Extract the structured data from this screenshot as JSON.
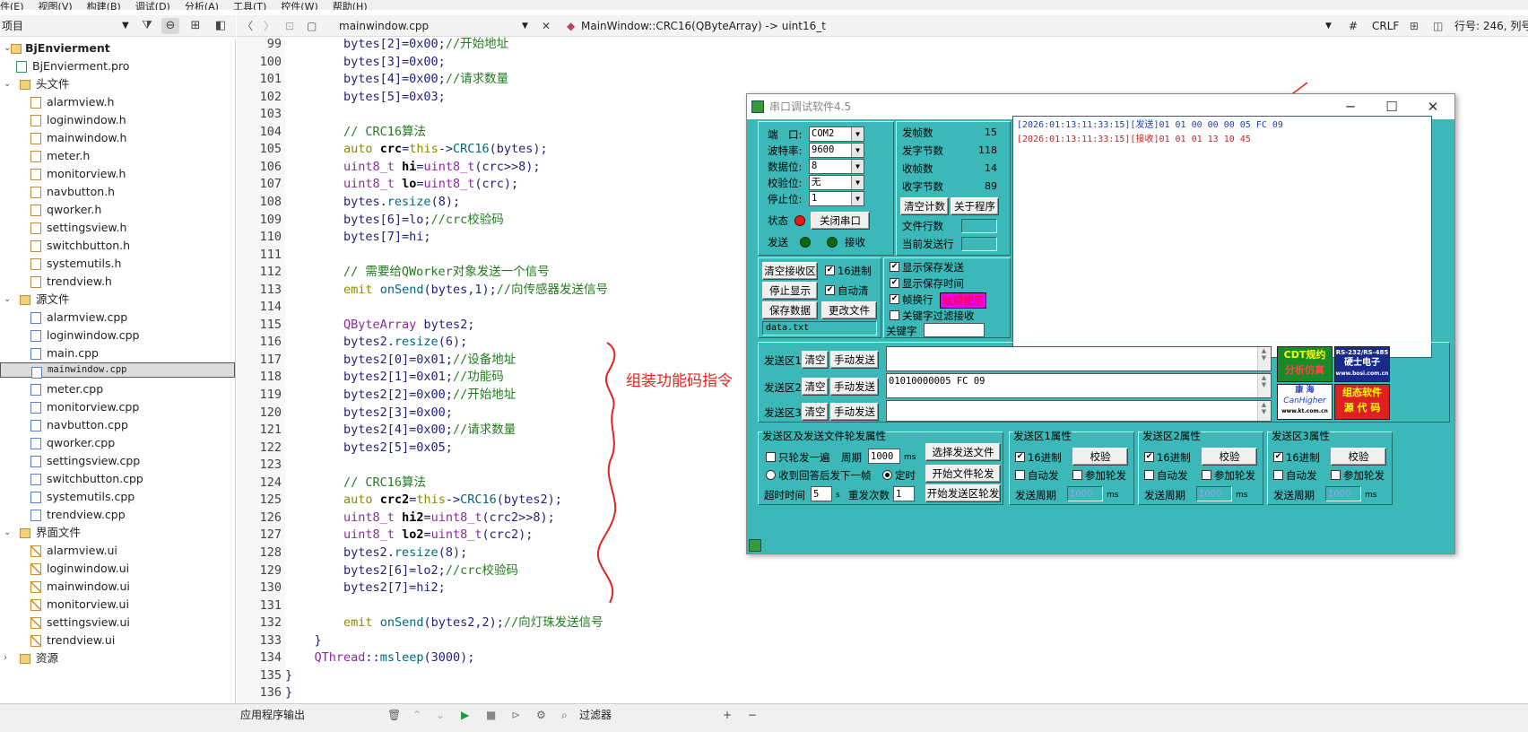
{
  "menu": [
    "件(E)",
    "视图(V)",
    "构建(B)",
    "调试(D)",
    "分析(A)",
    "工具(T)",
    "控件(W)",
    "帮助(H)"
  ],
  "left_toolbar": {
    "combo_label": "项目"
  },
  "tree": {
    "project": "BjEnvierment",
    "items": [
      {
        "label": "BjEnvierment.pro",
        "level": 1,
        "kind": "pro"
      },
      {
        "label": "头文件",
        "level": 1,
        "kind": "folder"
      },
      {
        "label": "alarmview.h",
        "level": 2,
        "kind": "h"
      },
      {
        "label": "loginwindow.h",
        "level": 2,
        "kind": "h"
      },
      {
        "label": "mainwindow.h",
        "level": 2,
        "kind": "h"
      },
      {
        "label": "meter.h",
        "level": 2,
        "kind": "h"
      },
      {
        "label": "monitorview.h",
        "level": 2,
        "kind": "h"
      },
      {
        "label": "navbutton.h",
        "level": 2,
        "kind": "h"
      },
      {
        "label": "qworker.h",
        "level": 2,
        "kind": "h"
      },
      {
        "label": "settingsview.h",
        "level": 2,
        "kind": "h"
      },
      {
        "label": "switchbutton.h",
        "level": 2,
        "kind": "h"
      },
      {
        "label": "systemutils.h",
        "level": 2,
        "kind": "h"
      },
      {
        "label": "trendview.h",
        "level": 2,
        "kind": "h"
      },
      {
        "label": "源文件",
        "level": 1,
        "kind": "folder"
      },
      {
        "label": "alarmview.cpp",
        "level": 2,
        "kind": "cpp"
      },
      {
        "label": "loginwindow.cpp",
        "level": 2,
        "kind": "cpp"
      },
      {
        "label": "main.cpp",
        "level": 2,
        "kind": "cpp"
      },
      {
        "label": "mainwindow.cpp",
        "level": 2,
        "kind": "cpp"
      },
      {
        "label": "meter.cpp",
        "level": 2,
        "kind": "cpp"
      },
      {
        "label": "monitorview.cpp",
        "level": 2,
        "kind": "cpp"
      },
      {
        "label": "navbutton.cpp",
        "level": 2,
        "kind": "cpp"
      },
      {
        "label": "qworker.cpp",
        "level": 2,
        "kind": "cpp"
      },
      {
        "label": "settingsview.cpp",
        "level": 2,
        "kind": "cpp"
      },
      {
        "label": "switchbutton.cpp",
        "level": 2,
        "kind": "cpp"
      },
      {
        "label": "systemutils.cpp",
        "level": 2,
        "kind": "cpp"
      },
      {
        "label": "trendview.cpp",
        "level": 2,
        "kind": "cpp"
      },
      {
        "label": "界面文件",
        "level": 1,
        "kind": "folder"
      },
      {
        "label": "alarmview.ui",
        "level": 2,
        "kind": "ui"
      },
      {
        "label": "loginwindow.ui",
        "level": 2,
        "kind": "ui"
      },
      {
        "label": "mainwindow.ui",
        "level": 2,
        "kind": "ui"
      },
      {
        "label": "monitorview.ui",
        "level": 2,
        "kind": "ui"
      },
      {
        "label": "settingsview.ui",
        "level": 2,
        "kind": "ui"
      },
      {
        "label": "trendview.ui",
        "level": 2,
        "kind": "ui"
      },
      {
        "label": "资源",
        "level": 1,
        "kind": "folder"
      }
    ],
    "selected_index": 17
  },
  "editor": {
    "file": "mainwindow.cpp",
    "function": "MainWindow::CRC16(QByteArray) -> uint16_t",
    "hash": "#",
    "line_ending": "CRLF",
    "position": "行号: 246, 列号",
    "line_numbers": [
      "99",
      "100",
      "101",
      "102",
      "103",
      "104",
      "105",
      "106",
      "107",
      "108",
      "109",
      "110",
      "111",
      "112",
      "113",
      "114",
      "115",
      "116",
      "117",
      "118",
      "119",
      "120",
      "121",
      "122",
      "123",
      "124",
      "125",
      "126",
      "127",
      "128",
      "129",
      "130",
      "131",
      "132",
      "133",
      "134",
      "135",
      "136"
    ],
    "lines": [
      "        bytes[2]=0x00;//开始地址",
      "        bytes[3]=0x00;",
      "        bytes[4]=0x00;//请求数量",
      "        bytes[5]=0x03;",
      "",
      "        // CRC16算法",
      "        auto crc=this->CRC16(bytes);",
      "        uint8_t hi=uint8_t(crc>>8);",
      "        uint8_t lo=uint8_t(crc);",
      "        bytes.resize(8);",
      "        bytes[6]=lo;//crc校验码",
      "        bytes[7]=hi;",
      "",
      "        // 需要给QWorker对象发送一个信号",
      "        emit onSend(bytes,1);//向传感器发送信号",
      "",
      "        QByteArray bytes2;",
      "        bytes2.resize(6);",
      "        bytes2[0]=0x01;//设备地址",
      "        bytes2[1]=0x01;//功能码",
      "        bytes2[2]=0x00;//开始地址",
      "        bytes2[3]=0x00;",
      "        bytes2[4]=0x00;//请求数量",
      "        bytes2[5]=0x05;",
      "",
      "        // CRC16算法",
      "        auto crc2=this->CRC16(bytes2);",
      "        uint8_t hi2=uint8_t(crc2>>8);",
      "        uint8_t lo2=uint8_t(crc2);",
      "        bytes2.resize(8);",
      "        bytes2[6]=lo2;//crc校验码",
      "        bytes2[7]=hi2;",
      "",
      "        emit onSend(bytes2,2);//向灯珠发送信号",
      "    }",
      "    QThread::msleep(3000);",
      "}",
      "}"
    ],
    "annotation": "组装功能码指令"
  },
  "bottom": {
    "output": "应用程序输出",
    "filter": "过滤器"
  },
  "serial": {
    "title": "串口调试软件4.5",
    "port_label": "端　口:",
    "port": "COM2",
    "baud_label": "波特率:",
    "baud": "9600",
    "data_label": "数据位:",
    "data_bits": "8",
    "parity_label": "校验位:",
    "parity": "无",
    "stop_label": "停止位:",
    "stop_bits": "1",
    "status_label": "状态",
    "close_port": "关闭串口",
    "send_label": "发送",
    "recv_label": "接收",
    "stats": [
      {
        "label": "发帧数",
        "value": "15"
      },
      {
        "label": "发字节数",
        "value": "118"
      },
      {
        "label": "收帧数",
        "value": "14"
      },
      {
        "label": "收字节数",
        "value": "89"
      }
    ],
    "clear_count": "清空计数",
    "about": "关于程序",
    "file_lines": "文件行数",
    "current_line": "当前发送行",
    "recv_lines": [
      {
        "text": "[2026:01:13:11:33:15][发送]01 01 00 00 00 05 FC 09",
        "color": "#1a3cc8"
      },
      {
        "text": "[2026:01:13:11:33:15][接收]01 01 01 13 10 45",
        "color": "#d02020"
      }
    ],
    "clear_recv": "清空接收区",
    "hex16": "16进制",
    "stop_display": "停止显示",
    "auto_clear": "自动清",
    "save_data": "保存数据",
    "change_file": "更改文件",
    "file_name": "data.txt",
    "show_save_send": "显示保存发送",
    "show_save_time": "显示保存时间",
    "frame_wrap": "帧换行",
    "welcome": "欢迎使用",
    "keyword_filter": "关键字过滤接收",
    "keyword": "关键字",
    "send_areas": [
      {
        "label": "发送区1",
        "clear": "清空",
        "manual": "手动发送",
        "value": ""
      },
      {
        "label": "发送区2",
        "clear": "清空",
        "manual": "手动发送",
        "value": "01010000005 FC 09"
      },
      {
        "label": "发送区3",
        "clear": "清空",
        "manual": "手动发送",
        "value": ""
      }
    ],
    "logos": {
      "cdt_1": "CDT规约",
      "cdt_2": "分析仿真",
      "rs_1": "RS-232/RS-485",
      "rs_2": "硬士电子",
      "rs_3": "www.bosi.com.cn",
      "kh_1": "康 海",
      "kh_2": "CanHigher",
      "kh_3": "www.kt.com.cn",
      "zt_1": "组态软件",
      "zt_2": "源 代 码"
    },
    "rotation": {
      "title": "发送区及发送文件轮发属性",
      "once": "只轮发一遍",
      "period_label": "周期",
      "period": "1000",
      "ms": "ms",
      "select_file": "选择发送文件",
      "reply_next": "收到回答后发下一帧",
      "timed": "定时",
      "start_file": "开始文件轮发",
      "timeout_label": "超时时间",
      "timeout": "5",
      "s": "s",
      "retry_label": "重发次数",
      "retry": "1",
      "start_area": "开始发送区轮发"
    },
    "area_props": [
      {
        "title": "发送区1属性",
        "hex": "16进制",
        "check": "校验",
        "auto": "自动发",
        "join": "参加轮发",
        "period_label": "发送周期",
        "period": "1000",
        "ms": "ms"
      },
      {
        "title": "发送区2属性",
        "hex": "16进制",
        "check": "校验",
        "auto": "自动发",
        "join": "参加轮发",
        "period_label": "发送周期",
        "period": "1000",
        "ms": "ms"
      },
      {
        "title": "发送区3属性",
        "hex": "16进制",
        "check": "校验",
        "auto": "自动发",
        "join": "参加轮发",
        "period_label": "发送周期",
        "period": "1000",
        "ms": "ms"
      }
    ]
  },
  "colors": {
    "teal": "#3cb8b8",
    "red_led": "#e81818",
    "green_led": "#0a6a0a",
    "annotation": "#e0251d"
  }
}
